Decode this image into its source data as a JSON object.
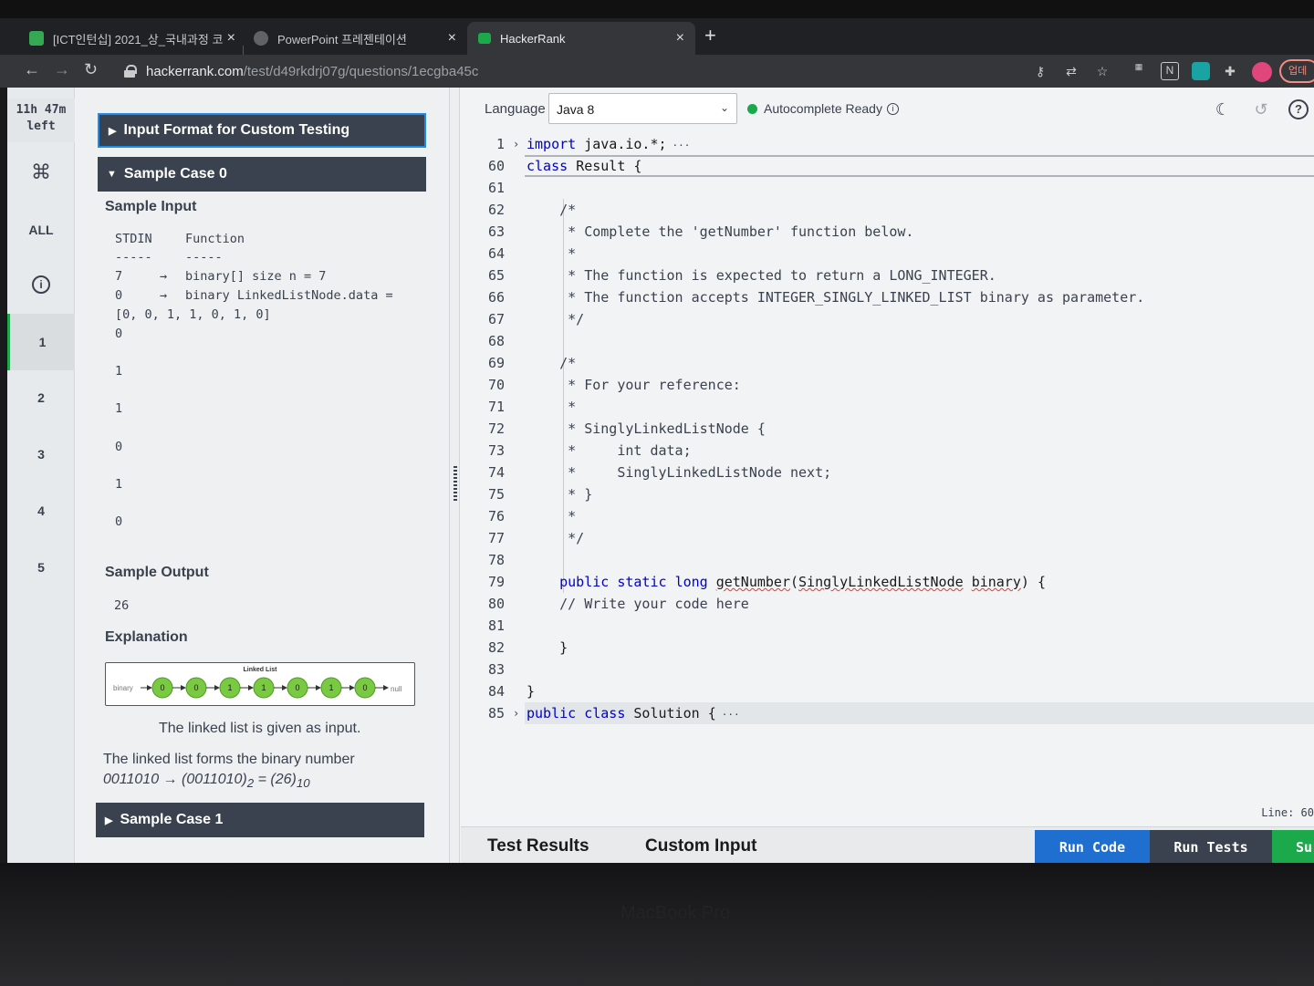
{
  "browser": {
    "tabs": [
      {
        "title": "[ICT인턴십] 2021_상_국내과정 코",
        "close": "×",
        "favicon_color": "#34a853"
      },
      {
        "title": "PowerPoint 프레젠테이션",
        "close": "×",
        "favicon_color": "#5f6368"
      },
      {
        "title": "HackerRank",
        "close": "×",
        "favicon_color": "#1ba94c"
      }
    ],
    "new_tab": "+",
    "url_host": "hackerrank.com",
    "url_path": "/test/d49rkdrj07g/questions/1ecgba45c",
    "update_label": "업데"
  },
  "rail": {
    "timer_line1": "11h 47m",
    "timer_line2": "left",
    "all_label": "ALL",
    "questions": [
      "1",
      "2",
      "3",
      "4",
      "5"
    ],
    "active_question": "1"
  },
  "problem": {
    "input_format_header": "Input Format for Custom Testing",
    "sample_case0_header": "Sample Case 0",
    "sample_input_label": "Sample Input",
    "stdin_header": "STDIN",
    "function_header": "Function",
    "stdin_rule": "-----",
    "function_rule": "-----",
    "rows": [
      {
        "stdin": "7",
        "arrow": "→",
        "function": "binary[] size n = 7"
      },
      {
        "stdin": "0",
        "arrow": "→",
        "function": "binary LinkedListNode.data ="
      }
    ],
    "array_line": "[0, 0, 1, 1, 0, 1, 0]",
    "values": [
      "0",
      "1",
      "1",
      "0",
      "1",
      "0"
    ],
    "sample_output_label": "Sample Output",
    "sample_output": "26",
    "explanation_label": "Explanation",
    "diagram": {
      "title": "Linked List",
      "start_label": "binary",
      "nodes": [
        "0",
        "0",
        "1",
        "1",
        "0",
        "1",
        "0"
      ],
      "end_label": "null"
    },
    "explain_line1": "The linked list is given as input.",
    "explain_line2": "The linked list forms the binary number",
    "explain_formula": "0011010 → (0011010)",
    "explain_sub2": "2",
    "explain_mid": " = (26)",
    "explain_sub10": "10",
    "sample_case1_header": "Sample Case 1"
  },
  "editor": {
    "language_label": "Language",
    "language_value": "Java 8",
    "autocomplete_label": "Autocomplete Ready",
    "status_line": "Line: 60",
    "lines": [
      {
        "n": "1",
        "text": "import java.io.*;"
      },
      {
        "n": "60",
        "text": "class Result {"
      },
      {
        "n": "61",
        "text": ""
      },
      {
        "n": "62",
        "text": "    /*"
      },
      {
        "n": "63",
        "text": "     * Complete the 'getNumber' function below."
      },
      {
        "n": "64",
        "text": "     *"
      },
      {
        "n": "65",
        "text": "     * The function is expected to return a LONG_INTEGER."
      },
      {
        "n": "66",
        "text": "     * The function accepts INTEGER_SINGLY_LINKED_LIST binary as parameter."
      },
      {
        "n": "67",
        "text": "     */"
      },
      {
        "n": "68",
        "text": ""
      },
      {
        "n": "69",
        "text": "    /*"
      },
      {
        "n": "70",
        "text": "     * For your reference:"
      },
      {
        "n": "71",
        "text": "     *"
      },
      {
        "n": "72",
        "text": "     * SinglyLinkedListNode {"
      },
      {
        "n": "73",
        "text": "     *     int data;"
      },
      {
        "n": "74",
        "text": "     *     SinglyLinkedListNode next;"
      },
      {
        "n": "75",
        "text": "     * }"
      },
      {
        "n": "76",
        "text": "     *"
      },
      {
        "n": "77",
        "text": "     */"
      },
      {
        "n": "78",
        "text": ""
      },
      {
        "n": "79",
        "text": "    public static long getNumber(SinglyLinkedListNode binary) {"
      },
      {
        "n": "80",
        "text": "    // Write your code here"
      },
      {
        "n": "81",
        "text": ""
      },
      {
        "n": "82",
        "text": "    }"
      },
      {
        "n": "83",
        "text": ""
      },
      {
        "n": "84",
        "text": "}"
      },
      {
        "n": "85",
        "text": "public class Solution {"
      }
    ],
    "fold_marker": "···",
    "test_results_tab": "Test Results",
    "custom_input_tab": "Custom Input",
    "run_code": "Run Code",
    "run_tests": "Run Tests",
    "submit": "Su"
  },
  "colors": {
    "accent_green": "#1ba94c",
    "run_code_blue": "#1f6fd1",
    "header_dark": "#39424e",
    "keyword_blue": "#0000cc"
  }
}
